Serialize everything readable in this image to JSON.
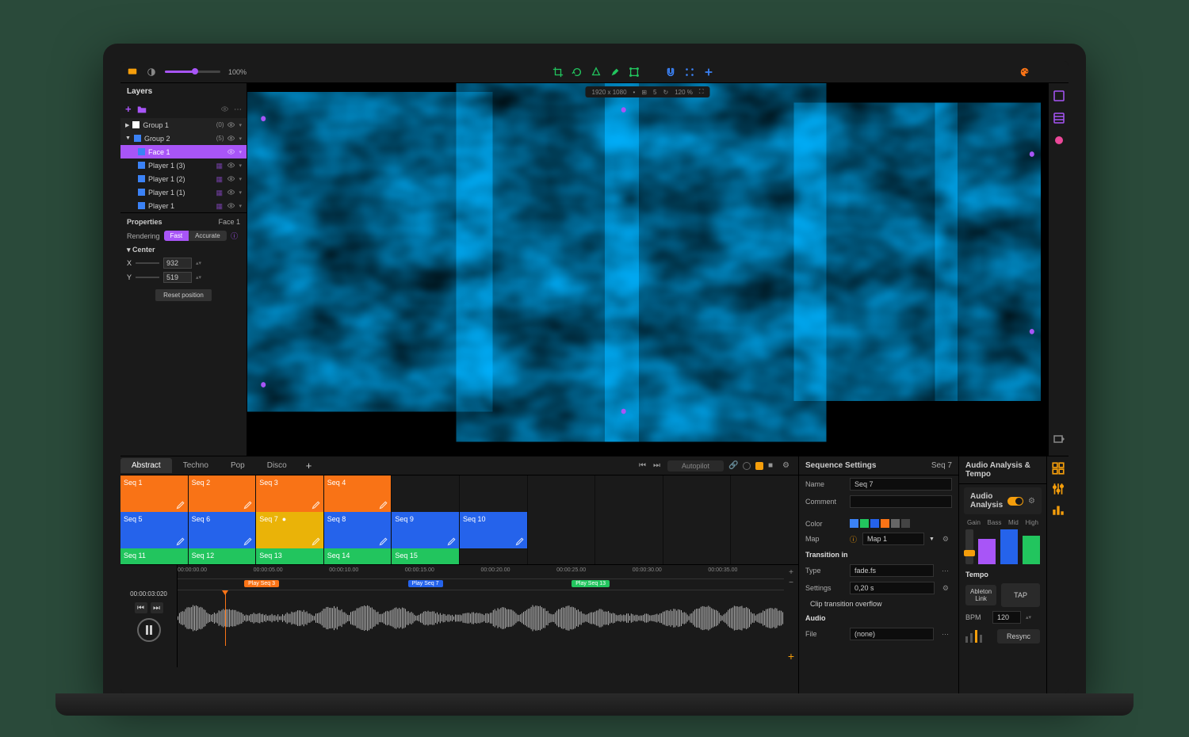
{
  "topbar": {
    "zoom_pct": "100%",
    "resolution": "1920 x 1080",
    "guide_count": "5",
    "zoom_level": "120 %"
  },
  "layers": {
    "title": "Layers",
    "items": [
      {
        "name": "Group 1",
        "count": "(0)",
        "type": "group",
        "color": "white"
      },
      {
        "name": "Group 2",
        "count": "(5)",
        "type": "group",
        "color": "blue",
        "expanded": true
      },
      {
        "name": "Face 1",
        "type": "face",
        "selected": true
      },
      {
        "name": "Player 1 (3)",
        "type": "player"
      },
      {
        "name": "Player 1 (2)",
        "type": "player"
      },
      {
        "name": "Player 1 (1)",
        "type": "player"
      },
      {
        "name": "Player 1",
        "type": "player"
      }
    ]
  },
  "properties": {
    "title": "Properties",
    "target": "Face 1",
    "rendering_label": "Rendering",
    "rendering_fast": "Fast",
    "rendering_accurate": "Accurate",
    "center_label": "Center",
    "x_label": "X",
    "x_value": "932",
    "y_label": "Y",
    "y_value": "519",
    "reset_label": "Reset position"
  },
  "tabs": {
    "items": [
      "Abstract",
      "Techno",
      "Pop",
      "Disco"
    ],
    "active": 0,
    "autopilot": "Autopilot"
  },
  "sequences": {
    "row1": [
      {
        "name": "Seq 1",
        "c": "orange"
      },
      {
        "name": "Seq 2",
        "c": "orange"
      },
      {
        "name": "Seq 3",
        "c": "orange"
      },
      {
        "name": "Seq 4",
        "c": "orange"
      },
      {},
      {},
      {},
      {},
      {},
      {}
    ],
    "row2": [
      {
        "name": "Seq 5",
        "c": "blue"
      },
      {
        "name": "Seq 6",
        "c": "blue"
      },
      {
        "name": "Seq 7",
        "c": "yellow",
        "active": true
      },
      {
        "name": "Seq 8",
        "c": "blue"
      },
      {
        "name": "Seq 9",
        "c": "blue"
      },
      {
        "name": "Seq 10",
        "c": "blue"
      },
      {},
      {},
      {},
      {}
    ],
    "row3": [
      {
        "name": "Seq 11",
        "c": "green"
      },
      {
        "name": "Seq 12",
        "c": "green"
      },
      {
        "name": "Seq 13",
        "c": "green"
      },
      {
        "name": "Seq 14",
        "c": "green"
      },
      {
        "name": "Seq 15",
        "c": "green"
      },
      {},
      {},
      {},
      {},
      {}
    ]
  },
  "timeline": {
    "current": "00:00:03:020",
    "ticks": [
      "00:00:00.00",
      "00:00:05.00",
      "00:00:10.00",
      "00:00:15.00",
      "00:00:20.00",
      "00:00:25.00",
      "00:00:30.00",
      "00:00:35.00"
    ],
    "markers": [
      {
        "label": "Play Seq 3",
        "pos": 11,
        "c": "orange"
      },
      {
        "label": "Play Seq 7",
        "pos": 38,
        "c": "blue"
      },
      {
        "label": "Play Seq 13",
        "pos": 65,
        "c": "green"
      }
    ]
  },
  "seq_settings": {
    "title": "Sequence Settings",
    "target": "Seq 7",
    "name_label": "Name",
    "name_value": "Seq 7",
    "comment_label": "Comment",
    "color_label": "Color",
    "map_label": "Map",
    "map_value": "Map 1",
    "transition_label": "Transition in",
    "type_label": "Type",
    "type_value": "fade.fs",
    "settings_label": "Settings",
    "settings_value": "0,20 s",
    "clip_overflow": "Clip transition overflow",
    "audio_label": "Audio",
    "file_label": "File",
    "file_value": "(none)"
  },
  "audio": {
    "title": "Audio Analysis & Tempo",
    "analysis_label": "Audio Analysis",
    "gain": "Gain",
    "bass": "Bass",
    "mid": "Mid",
    "high": "High",
    "tempo_label": "Tempo",
    "ableton": "Ableton Link",
    "tap": "TAP",
    "bpm_label": "BPM",
    "bpm_value": "120",
    "resync": "Resync"
  },
  "colors": {
    "swatches": [
      "#3b82f6",
      "#22c55e",
      "#2563eb",
      "#f97316",
      "#666",
      "#444"
    ]
  }
}
